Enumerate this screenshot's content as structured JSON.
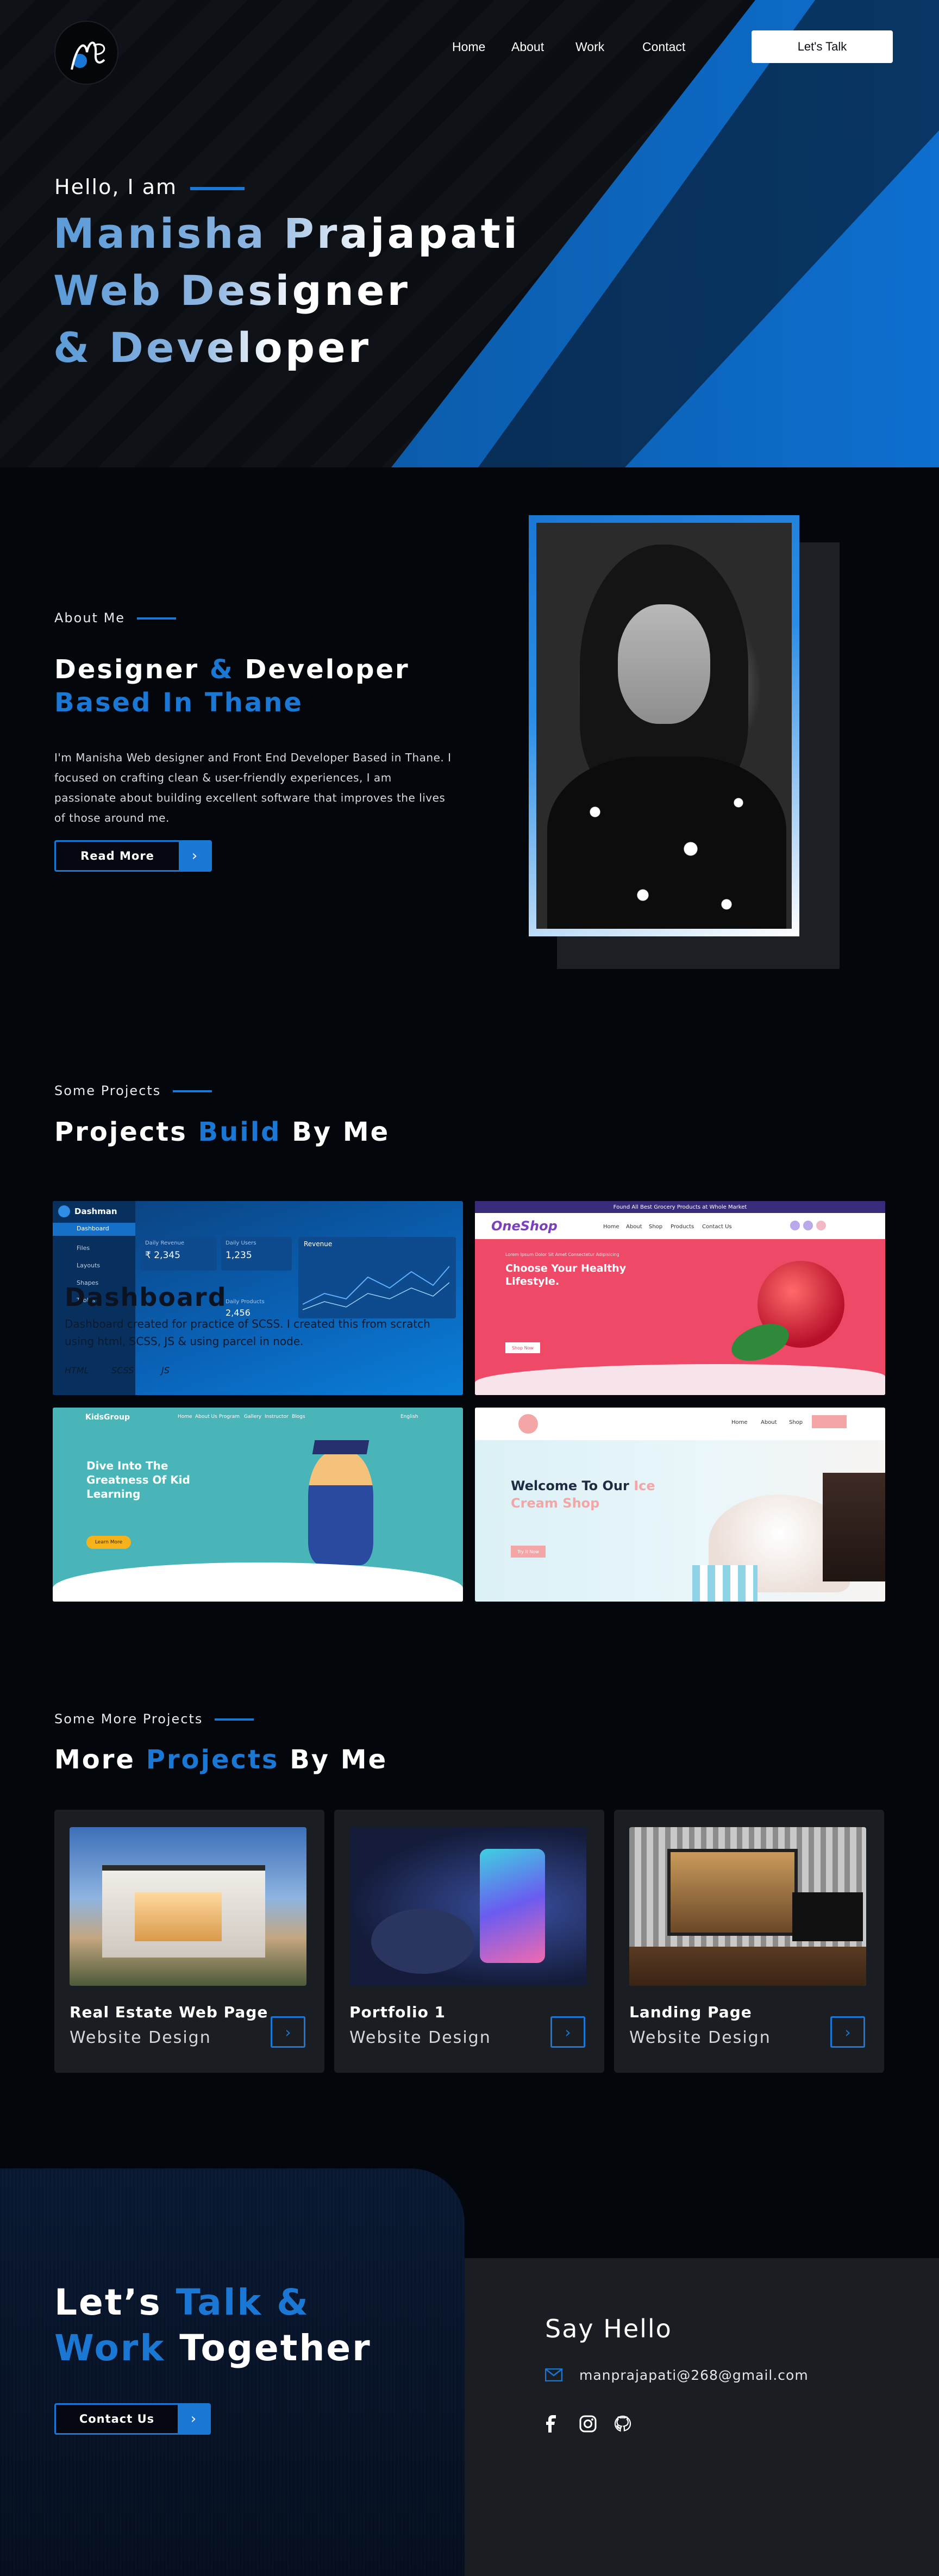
{
  "nav": {
    "logo_text": "MP",
    "links": [
      "Home",
      "About",
      "Work",
      "Contact"
    ],
    "cta": "Let's Talk"
  },
  "hero": {
    "greeting": "Hello, I am",
    "name": "Manisha Prajapati",
    "line2": "Web Designer",
    "line3": "& Developer"
  },
  "about": {
    "eyebrow": "About Me",
    "title_a": "Designer ",
    "title_amp": "&",
    "title_b": " Developer",
    "title_line2": "Based In Thane",
    "body": "I'm Manisha Web designer and Front End Developer Based in Thane. I focused on crafting clean & user-friendly experiences, I am passionate about building excellent software that improves the lives of those around me.",
    "button": "Read More"
  },
  "projects": {
    "eyebrow": "Some Projects",
    "title_a": "Projects ",
    "title_b": "Build",
    "title_c": " By Me",
    "dashboard": {
      "brand": "Dashman",
      "menu": [
        "Dashboard",
        "Files",
        "Layouts",
        "Shapes",
        "Tables"
      ],
      "stats": [
        {
          "label": "Daily Revenue",
          "value": "₹ 2,345"
        },
        {
          "label": "Daily Users",
          "value": "1,235"
        },
        {
          "label": "Daily Products",
          "value": "2,456"
        }
      ],
      "chart_label": "Revenue",
      "overlay_title": "Dashboard",
      "overlay_desc": "Dashboard created for practice of SCSS. I created this from scratch using html, SCSS, JS & using parcel in node.",
      "tags": [
        "HTML",
        "SCSS",
        "JS"
      ]
    },
    "shop": {
      "topbar": "Found All Best Grocery Products at Whole Market",
      "brand": "OneShop",
      "menu": [
        "Home",
        "About",
        "Shop",
        "Products",
        "Contact Us"
      ],
      "kicker": "Lorem Ipsum Dolor Sit Amet Consectetur Adipisicing",
      "headline": "Choose Your Healthy Lifestyle.",
      "button": "Shop Now"
    },
    "kid": {
      "brand": "KidsGroup",
      "menu": [
        "Home",
        "About Us",
        "Program",
        "Gallery",
        "Instructor",
        "Blogs"
      ],
      "lang": "English",
      "headline": "Dive Into The Greatness Of Kid Learning",
      "button": "Learn More"
    },
    "ice": {
      "menu": [
        "Home",
        "About",
        "Shop"
      ],
      "headline_a": "Welcome To Our ",
      "headline_b": "Ice",
      "headline_c": "Cream Shop",
      "button": "Try It Now"
    }
  },
  "more": {
    "eyebrow": "Some More Projects",
    "title_a": "More ",
    "title_b": "Projects",
    "title_c": " By Me",
    "cards": [
      {
        "title": "Real Estate Web Page",
        "subtitle": "Website Design"
      },
      {
        "title": "Portfolio 1",
        "subtitle": "Website Design"
      },
      {
        "title": "Landing Page",
        "subtitle": "Website Design"
      }
    ]
  },
  "contact": {
    "line1_a": "Let’s ",
    "line1_b": "Talk &",
    "line2_a": "Work",
    "line2_b": " Together",
    "button": "Contact Us",
    "say_hello": "Say Hello",
    "email": "manprajapati@268@gmail.com",
    "socials": [
      "facebook-icon",
      "instagram-icon",
      "github-icon"
    ]
  },
  "colors": {
    "accent": "#1a78d4",
    "background": "#03060b",
    "card": "#1a1d22"
  }
}
